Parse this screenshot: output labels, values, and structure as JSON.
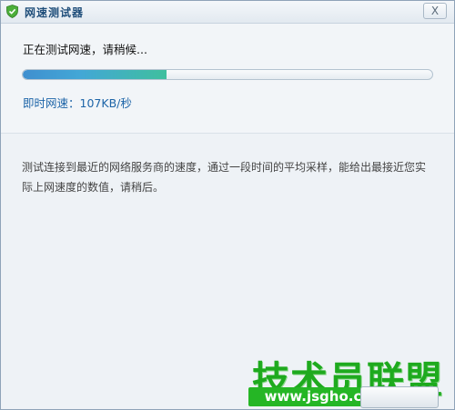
{
  "window": {
    "title": "网速测试器",
    "close_label": "X"
  },
  "status": {
    "message": "正在测试网速，请稍候...",
    "progress": 0.35,
    "speed_label": "即时网速：",
    "speed_value": "107KB/秒"
  },
  "description": {
    "text": "测试连接到最近的网络服务商的速度，通过一段时间的平均采样，能给出最接近您实际上网速度的数值，请稍后。"
  },
  "watermark": {
    "title": "技术员联盟",
    "url": "www.jsgho.com"
  },
  "colors": {
    "accent": "#1e65a8",
    "progress_start": "#3f8fcf",
    "progress_end": "#3fbf9e",
    "watermark_green": "#1eaa1e"
  },
  "icons": {
    "app": "shield-icon",
    "close": "close-icon"
  }
}
